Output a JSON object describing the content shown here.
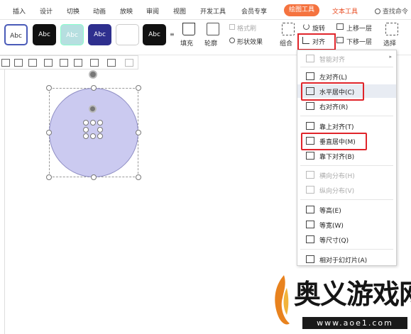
{
  "tabs": [
    "插入",
    "设计",
    "切换",
    "动画",
    "放映",
    "审阅",
    "视图",
    "开发工具",
    "会员专享"
  ],
  "active_tab": "绘图工具",
  "text_tab": "文本工具",
  "search_label": "查找命令",
  "ribbon": {
    "style_samples": [
      "Abc",
      "Abc",
      "Abc",
      "Abc",
      "",
      "Abc"
    ],
    "fill": "填充",
    "outline": "轮廓",
    "format_brush": "格式刷",
    "shape_effect": "形状效果",
    "combine": "组合",
    "rotate": "旋转",
    "align": "对齐",
    "bring_forward": "上移一层",
    "send_backward": "下移一层",
    "select": "选择"
  },
  "menu": {
    "items": [
      {
        "label": "智能对齐",
        "disabled": true
      },
      {
        "label": "左对齐(L)",
        "disabled": false
      },
      {
        "label": "水平居中(C)",
        "disabled": false
      },
      {
        "label": "右对齐(R)",
        "disabled": false
      },
      {
        "label": "靠上对齐(T)",
        "disabled": false
      },
      {
        "label": "垂直居中(M)",
        "disabled": false
      },
      {
        "label": "靠下对齐(B)",
        "disabled": false
      },
      {
        "label": "横向分布(H)",
        "disabled": true
      },
      {
        "label": "纵向分布(V)",
        "disabled": true
      },
      {
        "label": "等高(E)",
        "disabled": false
      },
      {
        "label": "等宽(W)",
        "disabled": false
      },
      {
        "label": "等尺寸(Q)",
        "disabled": false
      },
      {
        "label": "相对于幻灯片(A)",
        "disabled": false
      }
    ]
  },
  "watermark": {
    "text": "奥义游戏网",
    "url": "www.aoe1.com"
  },
  "colors": {
    "accent": "#f5733f",
    "highlight": "#e0242a",
    "shape_fill": "#cbcaf0"
  }
}
